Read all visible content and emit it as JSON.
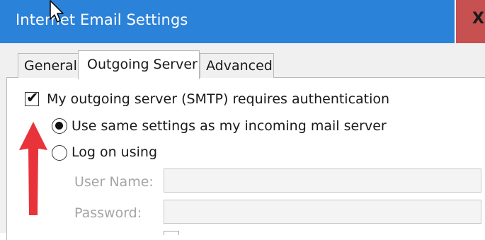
{
  "window": {
    "title": "Internet Email Settings",
    "close_label": "X"
  },
  "tabs": [
    {
      "label": "General",
      "active": false
    },
    {
      "label": "Outgoing Server",
      "active": true
    },
    {
      "label": "Advanced",
      "active": false
    }
  ],
  "outgoing": {
    "requires_auth_label": "My outgoing server (SMTP) requires authentication",
    "requires_auth_checked": true,
    "use_same_label": "Use same settings as my incoming mail server",
    "use_same_selected": true,
    "log_on_label": "Log on using",
    "log_on_selected": false,
    "username_label": "User Name:",
    "username_value": "",
    "password_label": "Password:",
    "password_value": ""
  },
  "colors": {
    "titlebar": "#2b82d9",
    "close_button": "#c75050",
    "annotation_arrow": "#e8333a"
  }
}
